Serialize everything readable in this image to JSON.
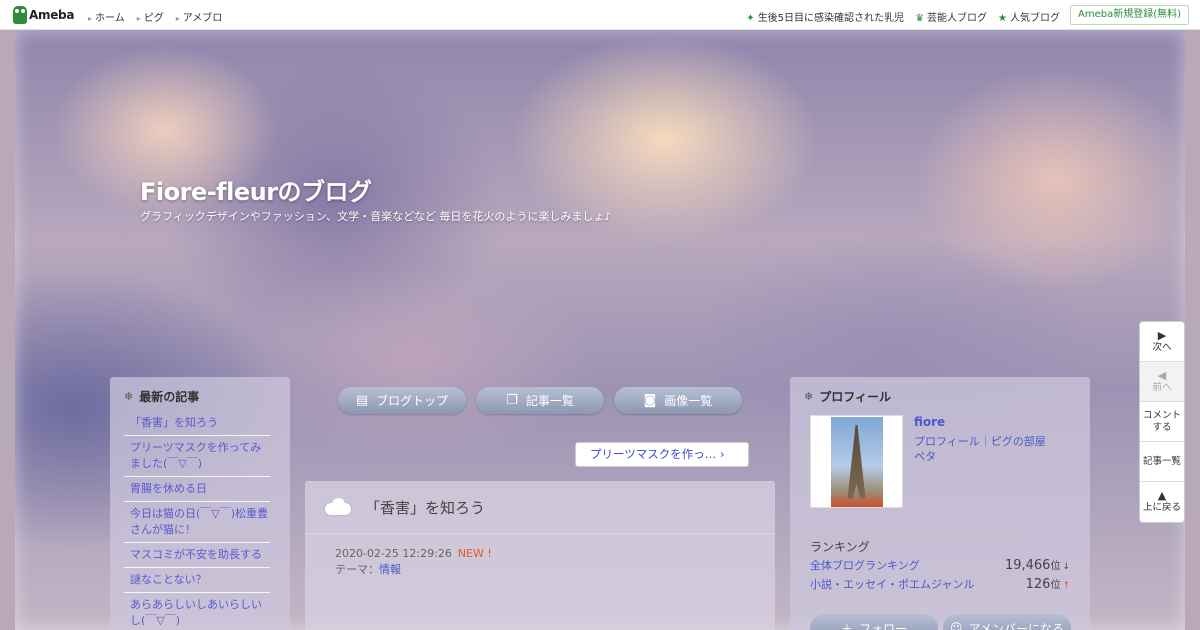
{
  "topbar": {
    "logo_text": "Ameba",
    "nav": [
      "ホーム",
      "ピグ",
      "アメブロ"
    ],
    "links": [
      {
        "icon": "plus-star-icon",
        "label": "生後5日目に感染確認された乳児"
      },
      {
        "icon": "crown-icon",
        "label": "芸能人ブログ"
      },
      {
        "icon": "star-icon",
        "label": "人気ブログ"
      }
    ],
    "register_label": "Ameba新規登録(無料)"
  },
  "header": {
    "title": "Fiore-fleurのブログ",
    "description": "グラフィックデザインやファッション、文学・音楽などなど 毎日を花火のように楽しみましょ♪"
  },
  "recent": {
    "heading": "最新の記事",
    "items": [
      "「香害」を知ろう",
      "プリーツマスクを作ってみました(￣▽￣)",
      "胃腸を休める日",
      "今日は猫の日(￣▽￣)松重豊さんが猫に！",
      "マスコミが不安を助長する",
      "謎なことない？",
      "あらあらしいしあいらしいし(￣▽￣)"
    ]
  },
  "nav_buttons": [
    "ブログトップ",
    "記事一覧",
    "画像一覧"
  ],
  "next_article": "プリーツマスクを作っ…",
  "article": {
    "title": "「香害」を知ろう",
    "datetime": "2020-02-25 12:29:26",
    "new_label": "NEW !",
    "theme_prefix": "テーマ：",
    "theme": "情報"
  },
  "profile": {
    "heading": "プロフィール",
    "name": "fiore",
    "links_line1": "プロフィール｜ピグの部屋",
    "links_line2": "ペタ",
    "ranking_title": "ランキング",
    "rankings": [
      {
        "label": "全体ブログランキング",
        "value": "19,466",
        "unit": "位",
        "trend": "↓"
      },
      {
        "label": "小説・エッセイ・ポエムジャンル",
        "value": "126",
        "unit": "位",
        "trend": "↑"
      }
    ],
    "follow_label": "フォロー",
    "member_label": "アメンバーになる"
  },
  "sidenav": {
    "next": "次へ",
    "prev": "前へ",
    "comment_line1": "コメント",
    "comment_line2": "する",
    "list": "記事一覧",
    "top": "上に戻る"
  }
}
